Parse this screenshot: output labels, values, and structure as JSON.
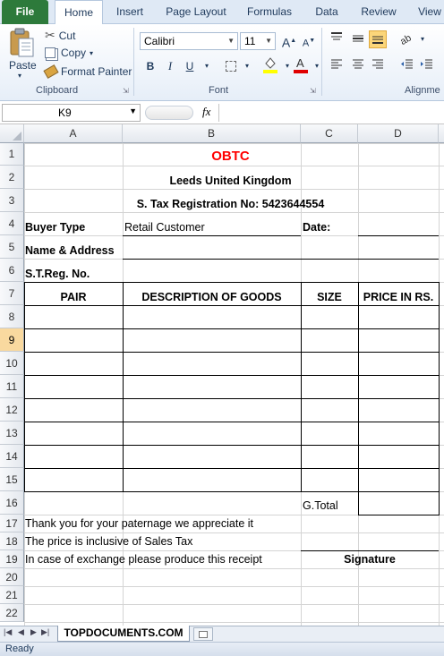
{
  "ribbon": {
    "tabs": [
      "File",
      "Home",
      "Insert",
      "Page Layout",
      "Formulas",
      "Data",
      "Review",
      "View"
    ],
    "clipboard": {
      "paste": "Paste",
      "cut": "Cut",
      "copy": "Copy",
      "format_painter": "Format Painter",
      "label": "Clipboard"
    },
    "font": {
      "name": "Calibri",
      "size": "11",
      "label": "Font",
      "bold": "B",
      "italic": "I",
      "underline": "U"
    },
    "alignment": {
      "label": "Alignme"
    }
  },
  "formula_bar": {
    "name_box": "K9",
    "fx": "fx",
    "value": ""
  },
  "columns": [
    "A",
    "B",
    "C",
    "D"
  ],
  "rows": [
    "1",
    "2",
    "3",
    "4",
    "5",
    "6",
    "7",
    "8",
    "9",
    "10",
    "11",
    "12",
    "13",
    "14",
    "15",
    "16",
    "17",
    "18",
    "19",
    "20",
    "21",
    "22"
  ],
  "sheet": {
    "title": "OBTC",
    "location": "Leeds United Kingdom",
    "tax_reg": "S. Tax Registration No: 5423644554",
    "buyer_type_label": "Buyer Type",
    "buyer_type_value": "Retail Customer",
    "date_label": "Date:",
    "name_address_label": "Name & Address",
    "streg_label": "S.T.Reg. No.",
    "headers": [
      "PAIR",
      "DESCRIPTION OF GOODS",
      "SIZE",
      "PRICE IN RS."
    ],
    "gtotal_label": "G.Total",
    "notes": [
      "Thank you for your paternage we appreciate it",
      "The price is inclusive of Sales Tax",
      "In case of exchange please produce this receipt"
    ],
    "signature_label": "Signature"
  },
  "sheet_tabs": [
    "TOPDOCUMENTS.COM"
  ],
  "status": {
    "ready": "Ready"
  },
  "colors": {
    "title": "#ff0000",
    "file_tab": "#2d7a3b",
    "selected_row": "#f9d99f"
  }
}
